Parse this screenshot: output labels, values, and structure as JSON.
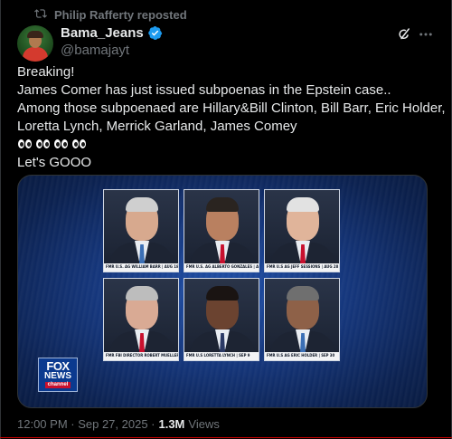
{
  "repost": {
    "text": "Philip Rafferty reposted",
    "icon": "repost-icon"
  },
  "author": {
    "display_name": "Bama_Jeans",
    "handle": "@bamajayt",
    "verified_color": "#1d9bf0"
  },
  "actions": {
    "grok_icon": "grok-icon",
    "more_icon": "more-horizontal-icon"
  },
  "tweet": {
    "lines": [
      "Breaking!",
      "James Comer has just issued subpoenas in the Epstein case..",
      "Among those subpoenaed are Hillary&Bill Clinton,  Bill Barr, Eric Holder,",
      "Loretta Lynch, Merrick Garland, James Comey"
    ],
    "emoji_count": 4,
    "last_line": "Let's GOOO"
  },
  "media": {
    "photos": [
      {
        "caption": "FMR U.S. AG WILLIAM BARR | AUG 18",
        "skin": "#d7a98e",
        "hair": "#cfcfcf",
        "tie": "#3b6fb5"
      },
      {
        "caption": "FMR U.S. AG ALBERTO GONZALES | AUG 26",
        "skin": "#b98060",
        "hair": "#2a2420",
        "tie": "#c8102e"
      },
      {
        "caption": "FMR U.S AG JEFF SESSIONS | AUG 28",
        "skin": "#e0b49a",
        "hair": "#e2e2e2",
        "tie": "#c8102e"
      },
      {
        "caption": "FMR FBI DIRECTOR ROBERT MUELLER | SEP 2",
        "skin": "#d9aa94",
        "hair": "#bdbdbd",
        "tie": "#c8102e"
      },
      {
        "caption": "FMR U.S LORETTA LYNCH | SEP 9",
        "skin": "#6b4330",
        "hair": "#1a1412",
        "tie": "#2b3a66"
      },
      {
        "caption": "FMR U.S AG ERIC HOLDER | SEP 30",
        "skin": "#8e6148",
        "hair": "#6f6f6f",
        "tie": "#3b6fb5"
      }
    ],
    "logo": {
      "fox": "FOX",
      "news": "NEWS",
      "channel": "channel"
    }
  },
  "meta": {
    "time": "12:00 PM · Sep 27, 2025 ·",
    "views_count": "1.3M",
    "views_label": "Views"
  }
}
